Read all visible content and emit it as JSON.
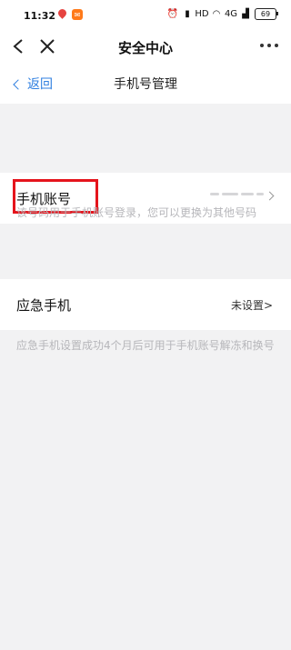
{
  "status_bar": {
    "time": "11:32",
    "battery": "69",
    "network_labels": [
      "4G",
      "HD"
    ]
  },
  "nav": {
    "title": "安全中心"
  },
  "sub_header": {
    "return_label": "返回",
    "title": "手机号管理"
  },
  "account": {
    "label": "手机账号",
    "hint": "该号码用于手机账号登录，您可以更换为其他号码"
  },
  "emergency": {
    "label": "应急手机",
    "value": "未设置>",
    "hint": "应急手机设置成功4个月后可用于手机账号解冻和换号"
  },
  "colors": {
    "accent": "#2f7fe0",
    "highlight": "#e5141c",
    "background": "#f2f2f3",
    "hint_text": "#b6b6ba"
  }
}
